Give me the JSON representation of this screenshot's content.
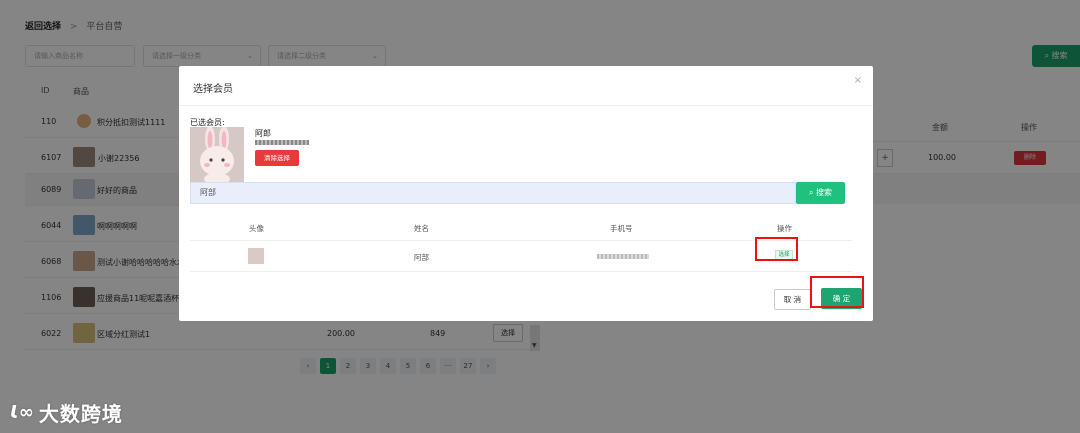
{
  "breadcrumb": {
    "back": "返回选择",
    "separator": ">",
    "current": "平台自营"
  },
  "filters": {
    "goods_name_placeholder": "请输入商品名称",
    "category1_placeholder": "请选择一级分类",
    "category2_placeholder": "请选择二级分类",
    "search_label": "搜索"
  },
  "goods_table": {
    "headers": {
      "id": "ID",
      "goods": "商品"
    },
    "rows": [
      {
        "id": "110",
        "name": "积分抵扣测试1111"
      },
      {
        "id": "6107",
        "name": "小谢22356"
      },
      {
        "id": "6089",
        "name": "好好的商品"
      },
      {
        "id": "6044",
        "name": "啊啊啊啊啊"
      },
      {
        "id": "6068",
        "name": "测试小谢哈哈哈哈哈水水"
      },
      {
        "id": "1106",
        "name": "应援商品11呢呢嘉酒杯"
      },
      {
        "id": "6022",
        "name": "区域分红测试1",
        "price": "200.00",
        "stock": "849",
        "action": "选择"
      }
    ]
  },
  "cart_table": {
    "headers": {
      "amount": "金额",
      "action": "操作"
    },
    "rows": [
      {
        "amount": "100.00",
        "delete_label": "删除",
        "plus": "+"
      }
    ]
  },
  "pagination": {
    "pages": [
      "1",
      "2",
      "3",
      "4",
      "5",
      "6",
      "···",
      "27"
    ],
    "prev": "‹",
    "next": "›",
    "active": "1"
  },
  "watermark": {
    "logo": "Ɩ∞",
    "text": "大数跨境"
  },
  "modal": {
    "title": "选择会员",
    "close": "×",
    "selected_label": "已选会员:",
    "selected_name": "阿郎",
    "clear_label": "清除选择",
    "search_value": "阿部",
    "search_label": "搜索",
    "table_headers": {
      "avatar": "头像",
      "name": "姓名",
      "phone": "手机号",
      "action": "操作"
    },
    "rows": [
      {
        "name": "阿部",
        "choose_label": "选择"
      }
    ],
    "cancel_label": "取 消",
    "ok_label": "确 定"
  },
  "colors": {
    "primary_green": "#1da56f",
    "danger_red": "#e83a3a",
    "highlight_red": "#e11111"
  }
}
